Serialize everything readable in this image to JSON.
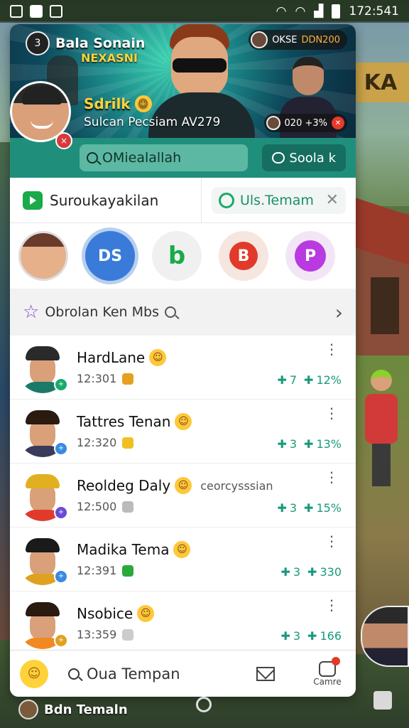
{
  "status_bar": {
    "time": "172:541"
  },
  "background": {
    "sign_text": "KA",
    "bottom_label": "Bdn Temaln"
  },
  "banner": {
    "avatar_label": "3",
    "name": "Bala Sonain",
    "subtitle": "NEXASNI",
    "top_chip": {
      "text_a": "OKSE ",
      "text_b": "DDN200"
    },
    "headline": "Sdrilk",
    "headline_emoji": "☺",
    "caption": "Sulcan Pecsiam AV279",
    "stat_chip": "020 +3%",
    "big_avatar_badge": "×"
  },
  "teal_strip": {
    "search_text": "OMiealallah",
    "button_label": "Soola k"
  },
  "tabs": {
    "left_label": "Suroukayakilan",
    "right_label": "Uls.Temam",
    "close_glyph": "✕"
  },
  "stories": [
    {
      "type": "photo",
      "label": ""
    },
    {
      "type": "blue",
      "label": "DS"
    },
    {
      "type": "green",
      "label": "b"
    },
    {
      "type": "red",
      "label": "B"
    },
    {
      "type": "purple",
      "label": "P"
    }
  ],
  "section": {
    "label": "Obrolan Ken Mbs",
    "chevron": "›"
  },
  "chats": [
    {
      "name": "HardLane",
      "extra": "",
      "time": "12:301",
      "stat1": "7",
      "stat2": "12%",
      "hair": "#2a2a2a",
      "shirt": "#1a7a6a",
      "badge_color": "#1aaa6c",
      "badge": "+",
      "mini": "#e6a020"
    },
    {
      "name": "Tattres Tenan",
      "extra": "",
      "time": "12:320",
      "stat1": "3",
      "stat2": "13%",
      "hair": "#2a1a10",
      "shirt": "#3a3a5a",
      "badge_color": "#3a8ae0",
      "badge": "+",
      "mini": "#f0c020"
    },
    {
      "name": "Reoldeg Daly",
      "extra": "ceorcysssian",
      "time": "12:500",
      "stat1": "3",
      "stat2": "15%",
      "hair": "#e0b020",
      "shirt": "#e23a2a",
      "badge_color": "#6a4ad8",
      "badge": "+",
      "mini": "#bbbbbb"
    },
    {
      "name": "Madika Tema",
      "extra": "",
      "time": "12:391",
      "stat1": "3",
      "stat2": "330",
      "hair": "#1a1a1a",
      "shirt": "#e0a020",
      "badge_color": "#3a8ae0",
      "badge": "+",
      "mini": "#2aaa3a"
    },
    {
      "name": "Nsobice",
      "extra": "",
      "time": "13:359",
      "stat1": "3",
      "stat2": "166",
      "hair": "#2a1a10",
      "shirt": "#f08a20",
      "badge_color": "#e0a020",
      "badge": "+",
      "mini": "#cccccc"
    }
  ],
  "bottom_bar": {
    "search_label": "Oua Tempan",
    "camera_label": "Camre"
  }
}
